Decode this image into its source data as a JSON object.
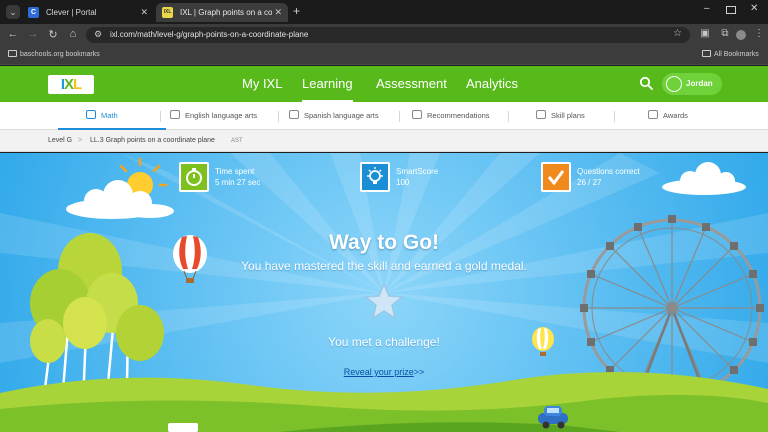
{
  "browser": {
    "tab_list_icon": "chevron-down",
    "tabs": [
      {
        "title": "Clever | Portal",
        "favicon": "C"
      },
      {
        "title": "IXL | Graph points on a coordin",
        "favicon": "IXL"
      }
    ],
    "new_tab_icon": "+",
    "url": "ixl.com/math/level-g/graph-points-on-a-coordinate-plane",
    "bookmarks": {
      "left": "baschools.org bookmarks",
      "right": "All Bookmarks"
    }
  },
  "ixl": {
    "logo": {
      "i": "I",
      "x": "X",
      "l": "L"
    },
    "nav": [
      "My IXL",
      "Learning",
      "Assessment",
      "Analytics"
    ],
    "active_nav": "Learning",
    "user": "Jordan",
    "subnav": [
      "Math",
      "English language arts",
      "Spanish language arts",
      "Recommendations",
      "Skill plans",
      "Awards"
    ],
    "active_subnav": "Math",
    "breadcrumb": {
      "level": "Level G",
      "separator": ">",
      "skill": "LL.3 Graph points on a coordinate plane",
      "code": "AST"
    }
  },
  "award": {
    "stats": [
      {
        "label": "Time spent",
        "value": "5 min 27 sec",
        "color": "#7dc11e",
        "icon": "stopwatch-icon"
      },
      {
        "label": "SmartScore",
        "value": "100",
        "color": "#1b8fd6",
        "icon": "lightbulb-icon"
      },
      {
        "label": "Questions correct",
        "value": "26 / 27",
        "color": "#f08a1c",
        "icon": "checkmark-icon"
      }
    ],
    "headline": "Way to Go!",
    "message": "You have mastered the skill and earned a gold medal.",
    "challenge": "You met a challenge!",
    "reveal_link": "Reveal your prize",
    "reveal_suffix": ">>"
  },
  "colors": {
    "ixl_green": "#58b91b",
    "sky": "#43b6f0",
    "link_blue": "#1e8dd8"
  }
}
